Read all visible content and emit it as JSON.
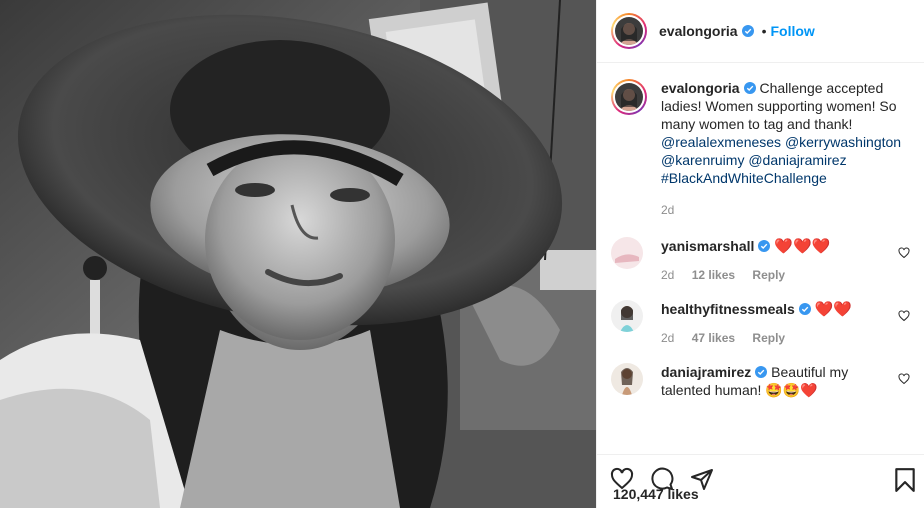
{
  "post": {
    "author": "evalongoria",
    "follow_dot": "•",
    "follow_label": "Follow",
    "caption_start": "Challenge accepted ladies! Women supporting women! So many women to tag and thank!",
    "caption_mentions": [
      "@realalexmeneses",
      "@kerrywashington",
      "@karenruimy",
      "@daniajramirez"
    ],
    "caption_hashtag": "#BlackAndWhiteChallenge",
    "caption_time": "2d",
    "likes": "120,447 likes"
  },
  "comments": [
    {
      "user": "yanismarshall",
      "text": "❤️❤️❤️",
      "time": "2d",
      "likes": "12 likes",
      "reply": "Reply"
    },
    {
      "user": "healthyfitnessmeals",
      "text": "❤️❤️",
      "time": "2d",
      "likes": "47 likes",
      "reply": "Reply"
    },
    {
      "user": "daniajramirez",
      "text": "Beautiful my talented human! 🤩🤩❤️",
      "time": "",
      "likes": "",
      "reply": ""
    }
  ],
  "icons": {
    "verified": "verified-badge-icon",
    "like": "heart-icon",
    "comment": "comment-icon",
    "share": "paper-plane-icon",
    "save": "bookmark-icon",
    "comment_like": "small-heart-icon"
  },
  "colors": {
    "accent": "#0095f6",
    "link": "#00376b",
    "muted": "#8e8e8e",
    "text": "#262626"
  }
}
